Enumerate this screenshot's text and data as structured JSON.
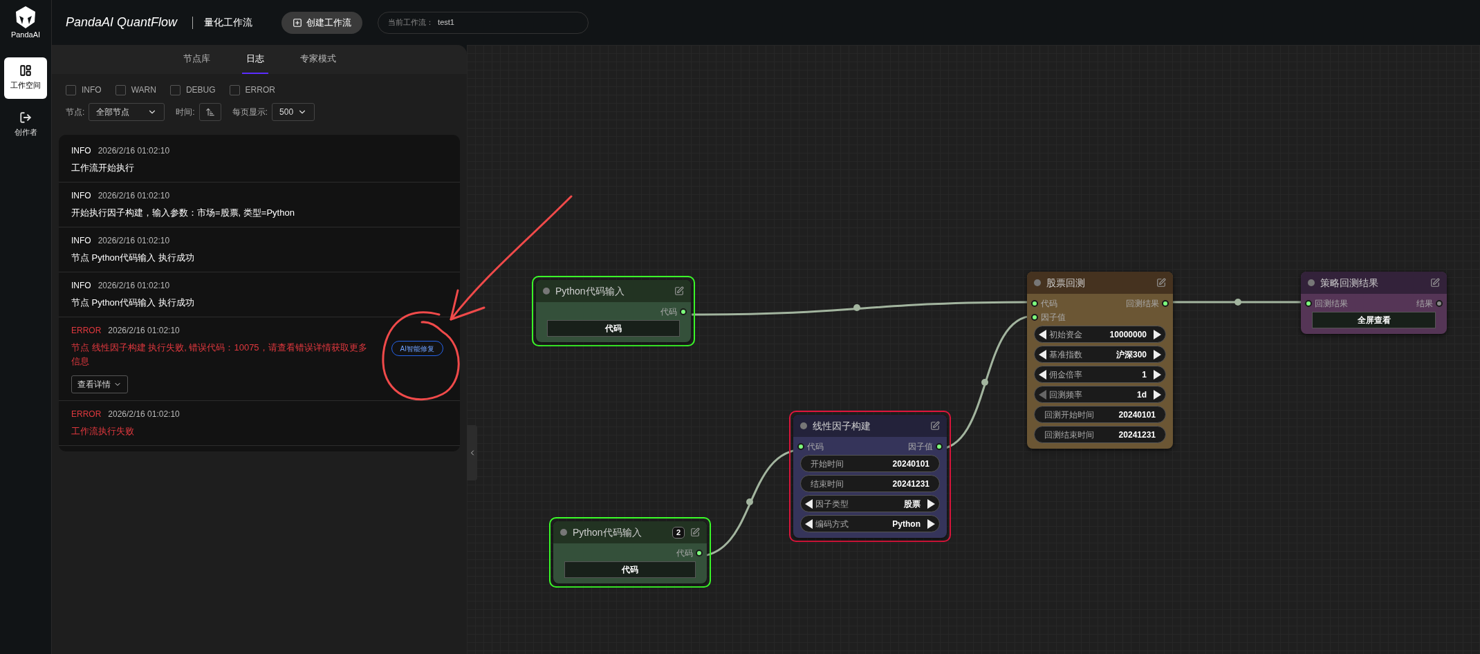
{
  "sidebar": {
    "logo_text": "PandaAI",
    "items": [
      {
        "label": "工作空间",
        "kind": "workspace",
        "selected": true
      },
      {
        "label": "创作者",
        "kind": "creator",
        "selected": false
      }
    ]
  },
  "header": {
    "title": "PandaAI QuantFlow",
    "subtitle": "量化工作流",
    "create_button": "创建工作流",
    "current_label": "当前工作流：",
    "current_value": "test1"
  },
  "panel": {
    "tabs": [
      {
        "label": "节点库",
        "selected": false
      },
      {
        "label": "日志",
        "selected": true
      },
      {
        "label": "专家模式",
        "selected": false
      }
    ],
    "filters": [
      {
        "label": "INFO",
        "checked": false
      },
      {
        "label": "WARN",
        "checked": false
      },
      {
        "label": "DEBUG",
        "checked": false
      },
      {
        "label": "ERROR",
        "checked": false
      }
    ],
    "node_label": "节点:",
    "node_select": "全部节点",
    "time_label": "时间:",
    "page_label": "每页显示:",
    "page_select": "500",
    "logs": [
      {
        "kind": "info",
        "level": "INFO",
        "time": "2026/2/16 01:02:10",
        "message": "工作流开始执行"
      },
      {
        "kind": "info",
        "level": "INFO",
        "time": "2026/2/16 01:02:10",
        "message": "开始执行因子构建，输入参数：市场=股票, 类型=Python"
      },
      {
        "kind": "info",
        "level": "INFO",
        "time": "2026/2/16 01:02:10",
        "message": "节点 Python代码输入 执行成功"
      },
      {
        "kind": "info",
        "level": "INFO",
        "time": "2026/2/16 01:02:10",
        "message": "节点 Python代码输入 执行成功"
      },
      {
        "kind": "error",
        "level": "ERROR",
        "time": "2026/2/16 01:02:10",
        "message": "节点 线性因子构建 执行失败, 错误代码：10075，请查看错误详情获取更多信息",
        "repair_button": "AI智能修复",
        "details_button": "查看详情"
      },
      {
        "kind": "error",
        "level": "ERROR",
        "time": "2026/2/16 01:02:10",
        "message": "工作流执行失败"
      }
    ]
  },
  "canvas": {
    "nodes": [
      {
        "kind": "input",
        "color": "#3cff2a",
        "title": "Python代码输入",
        "ports": [
          {
            "output": {
              "label": "代码",
              "connected": true
            }
          }
        ],
        "fields": [
          {
            "kind": "button",
            "label": "代码"
          }
        ]
      },
      {
        "kind": "input",
        "color": "#3cff2a",
        "title": "Python代码输入",
        "badge": "2",
        "ports": [
          {
            "output": {
              "label": "代码",
              "connected": true
            }
          }
        ],
        "fields": [
          {
            "kind": "button",
            "label": "代码"
          }
        ]
      },
      {
        "kind": "factor",
        "color": "#e0163d",
        "title": "线性因子构建",
        "ports": [
          {
            "input": {
              "label": "代码",
              "connected": true
            },
            "output": {
              "label": "因子值",
              "connected": true
            }
          }
        ],
        "fields": [
          {
            "kind": "text",
            "label": "开始时间",
            "value": "20240101"
          },
          {
            "kind": "text",
            "label": "结束时间",
            "value": "20241231"
          },
          {
            "kind": "stepper",
            "label": "因子类型",
            "value": "股票",
            "prev_disabled": false
          },
          {
            "kind": "stepper",
            "label": "编码方式",
            "value": "Python",
            "prev_disabled": false
          }
        ]
      },
      {
        "kind": "backtest",
        "title": "股票回测",
        "ports": [
          {
            "input": {
              "label": "代码",
              "connected": true
            },
            "output": {
              "label": "回测结果",
              "connected": true
            }
          },
          {
            "input": {
              "label": "因子值",
              "connected": true
            }
          }
        ],
        "fields": [
          {
            "kind": "stepper",
            "label": "初始资金",
            "value": "10000000",
            "prev_disabled": false
          },
          {
            "kind": "stepper",
            "label": "基准指数",
            "value": "沪深300",
            "prev_disabled": false
          },
          {
            "kind": "stepper",
            "label": "佣金倍率",
            "value": "1",
            "prev_disabled": false
          },
          {
            "kind": "stepper",
            "label": "回测频率",
            "value": "1d",
            "prev_disabled": true
          },
          {
            "kind": "text",
            "label": "回测开始时间",
            "value": "20240101"
          },
          {
            "kind": "text",
            "label": "回测结束时间",
            "value": "20241231"
          }
        ]
      },
      {
        "kind": "result",
        "title": "策略回测结果",
        "ports": [
          {
            "input": {
              "label": "回测结果",
              "connected": true
            },
            "output": {
              "label": "结果",
              "connected": false
            }
          }
        ],
        "fields": [
          {
            "kind": "button",
            "label": "全屏查看"
          }
        ]
      }
    ]
  }
}
